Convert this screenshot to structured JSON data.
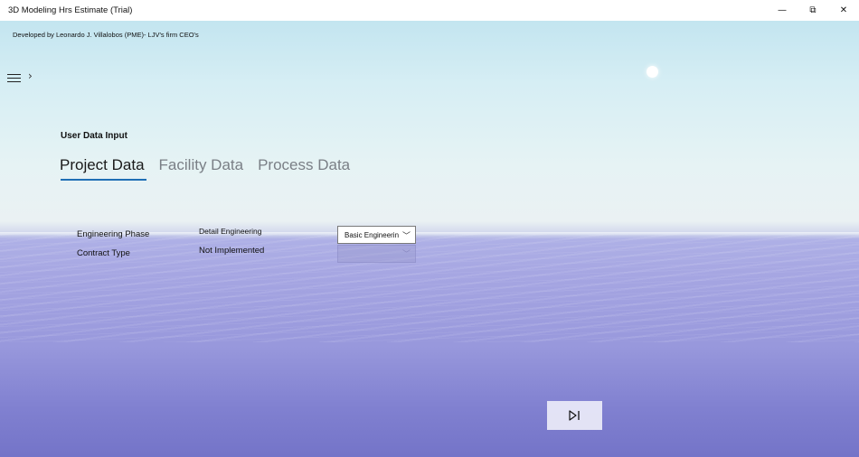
{
  "window": {
    "title": "3D Modeling Hrs Estimate (Trial)",
    "minimize_glyph": "—",
    "restore_glyph": "⧉",
    "close_glyph": "✕"
  },
  "header": {
    "credit": "Developed by Leonardo J. Villalobos (PME)- LJV's firm CEO's",
    "menu_chevron": "›"
  },
  "main": {
    "section_label": "User Data Input",
    "tabs": [
      {
        "label": "Project Data",
        "active": true
      },
      {
        "label": "Facility Data",
        "active": false
      },
      {
        "label": "Process Data",
        "active": false
      }
    ],
    "fields": [
      {
        "label": "Engineering Phase",
        "value": "Detail Engineering",
        "dropdown_selected": "Basic Engineering"
      },
      {
        "label": "Contract Type",
        "value": "Not Implemented",
        "dropdown_selected": ""
      }
    ],
    "next_button_icon": "skip-next-icon"
  },
  "colors": {
    "tab_underline": "#1f6fb5",
    "sky_top": "#c3e5f0",
    "sea_bottom": "#7474c8"
  }
}
